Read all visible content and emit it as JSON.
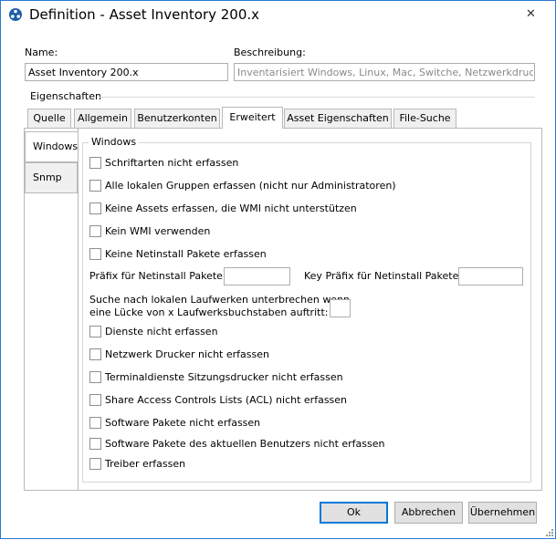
{
  "window": {
    "title": "Definition - Asset Inventory 200.x",
    "close_glyph": "✕",
    "icon": "app-logo-icon",
    "accent": "#2b79d6"
  },
  "fields": {
    "name_label": "Name:",
    "name_value": "Asset Inventory 200.x",
    "description_label": "Beschreibung:",
    "description_value": "Inventarisiert Windows, Linux, Mac, Switche, Netzwerkdrucker, Hyp"
  },
  "properties": {
    "group_label": "Eigenschaften",
    "tabs": [
      "Quelle",
      "Allgemein",
      "Benutzerkonten",
      "Erweitert",
      "Asset Eigenschaften",
      "File-Suche"
    ],
    "active_tab": "Erweitert",
    "vertical_tabs": [
      "Windows",
      "Snmp"
    ]
  },
  "windows_section": {
    "title": "Windows",
    "checkboxes_top": [
      "Schriftarten nicht erfassen",
      "Alle lokalen Gruppen erfassen (nicht nur Administratoren)",
      "Keine Assets erfassen, die WMI nicht unterstützen",
      "Kein WMI verwenden",
      "Keine Netinstall Pakete erfassen"
    ],
    "prefix_label": "Präfix für Netinstall Pakete:",
    "prefix_value": "",
    "key_prefix_label": "Key Präfix für Netinstall Pakete:",
    "key_prefix_value": "",
    "drive_gap_label_line1": "Suche nach lokalen Laufwerken unterbrechen wenn",
    "drive_gap_label_line2": "eine Lücke von x Laufwerksbuchstaben auftritt:",
    "drive_gap_value": "",
    "checkboxes_bottom": [
      "Dienste nicht erfassen",
      "Netzwerk Drucker nicht erfassen",
      "Terminaldienste Sitzungsdrucker nicht erfassen",
      "Share Access Controls Lists (ACL) nicht erfassen",
      "Software Pakete nicht erfassen",
      "Software Pakete des aktuellen Benutzers nicht erfassen",
      "Treiber erfassen"
    ]
  },
  "buttons": {
    "ok": "Ok",
    "cancel": "Abbrechen",
    "apply": "Übernehmen"
  }
}
